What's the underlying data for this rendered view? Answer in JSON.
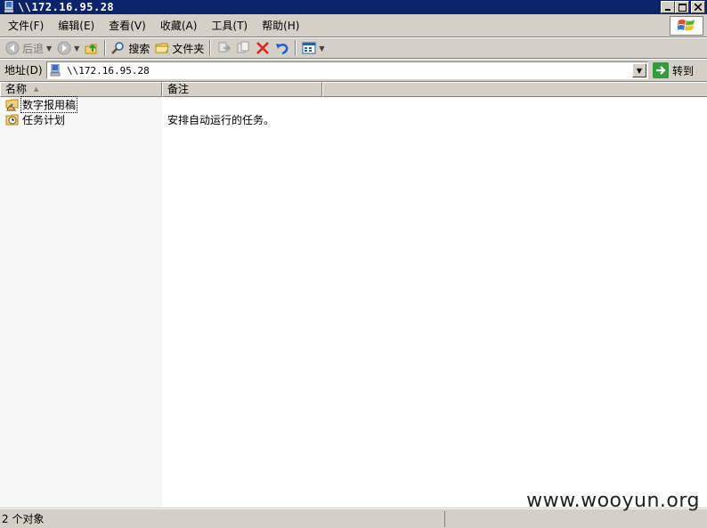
{
  "window": {
    "title": "\\\\172.16.95.28"
  },
  "menu": {
    "items": [
      "文件(F)",
      "编辑(E)",
      "查看(V)",
      "收藏(A)",
      "工具(T)",
      "帮助(H)"
    ]
  },
  "toolbar": {
    "back_label": "后退",
    "search_label": "搜索",
    "folders_label": "文件夹"
  },
  "address": {
    "label": "地址(D)",
    "value": "\\\\172.16.95.28",
    "go_label": "转到"
  },
  "columns": {
    "name": "名称",
    "note": "备注"
  },
  "rows": [
    {
      "name": "数字报用稿",
      "note": "",
      "icon": "shared-folder-icon"
    },
    {
      "name": "任务计划",
      "note": "安排自动运行的任务。",
      "icon": "scheduled-tasks-folder-icon"
    }
  ],
  "status": {
    "text": "2 个对象"
  },
  "watermark": "www.wooyun.org"
}
